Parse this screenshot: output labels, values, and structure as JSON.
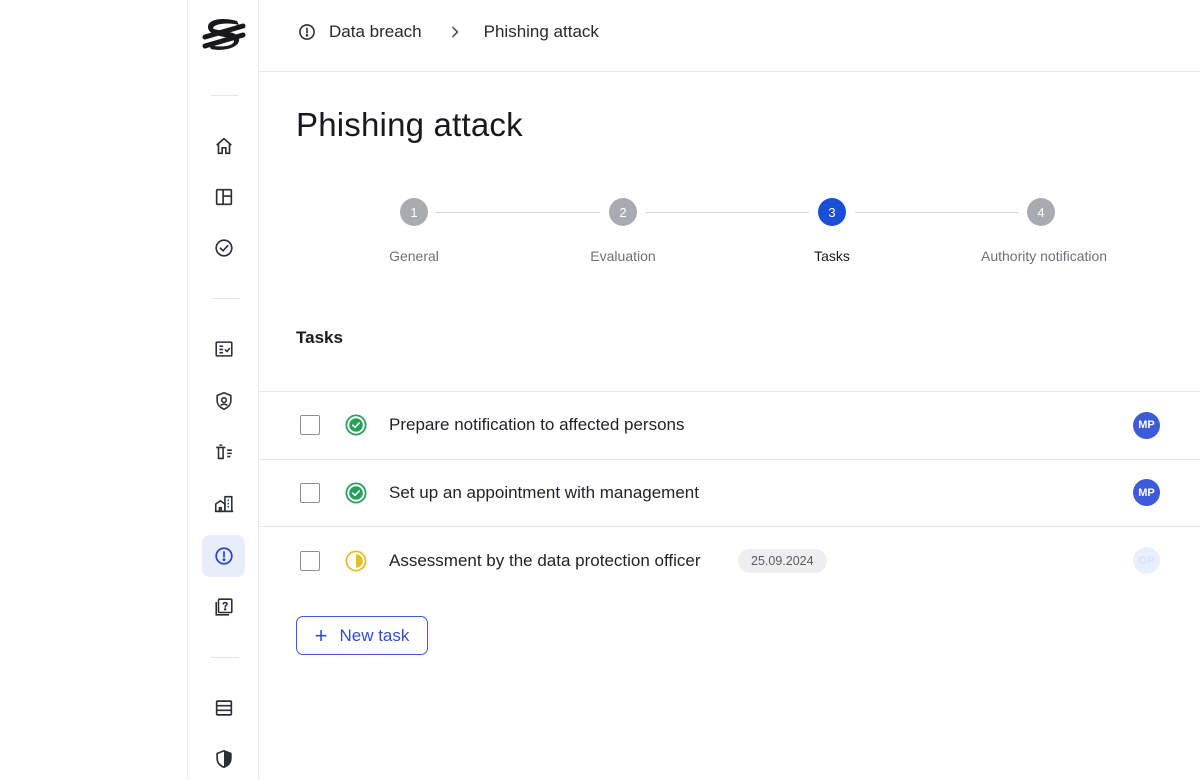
{
  "breadcrumb": {
    "items": [
      "Data breach",
      "Phishing attack"
    ]
  },
  "page": {
    "title": "Phishing attack"
  },
  "stepper": {
    "steps": [
      {
        "number": "1",
        "label": "General",
        "state": "inactive"
      },
      {
        "number": "2",
        "label": "Evaluation",
        "state": "inactive"
      },
      {
        "number": "3",
        "label": "Tasks",
        "state": "active"
      },
      {
        "number": "4",
        "label": "Authority notification",
        "state": "inactive"
      }
    ]
  },
  "tasks": {
    "section_title": "Tasks",
    "rows": [
      {
        "name": "Prepare notification to affected persons",
        "status": "done",
        "date": "",
        "assignee": "MP"
      },
      {
        "name": "Set up an appointment with management",
        "status": "done",
        "date": "",
        "assignee": "MP"
      },
      {
        "name": "Assessment by the data protection officer",
        "status": "in-progress",
        "date": "25.09.2024",
        "assignee": "OP"
      }
    ],
    "new_task_label": "New task"
  },
  "sidebar": {
    "icons": [
      "home-icon",
      "layout-icon",
      "check-circle-icon",
      "checklist-icon",
      "shield-user-icon",
      "delete-list-icon",
      "buildings-icon",
      "alert-icon",
      "question-book-icon",
      "rows-icon",
      "shield-half-icon"
    ],
    "active": "alert-icon"
  },
  "colors": {
    "accent": "#1a4ed6",
    "success": "#27a05a",
    "warning": "#e9bd2a",
    "avatar": "#3b5bdb"
  }
}
